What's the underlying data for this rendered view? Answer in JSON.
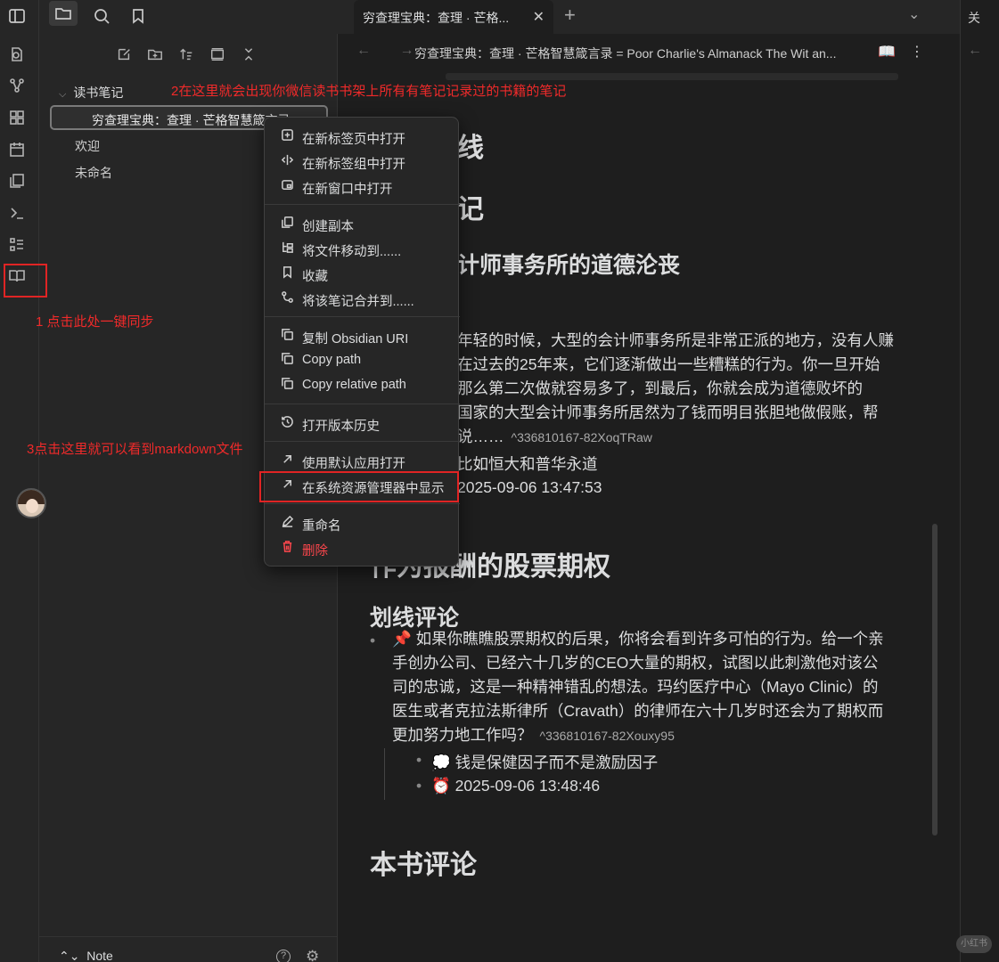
{
  "tab": {
    "title": "穷查理宝典：查理 · 芒格...",
    "close": "✕",
    "add": "+",
    "dropdown": "⌄"
  },
  "right_pane_tab": "关",
  "sidebar": {
    "folder": "读书笔记",
    "active_file": "穷查理宝典：查理 · 芒格智慧箴言录",
    "files": [
      "欢迎",
      "未命名"
    ],
    "vault_name": "Note",
    "help": "?"
  },
  "view": {
    "title": "穷查理宝典：查理 · 芒格智慧箴言录 = Poor Charlie's Almanack The Wit an...",
    "nav": "← →",
    "more": "⋮"
  },
  "content": {
    "h2_1": "线",
    "h2_2": "记",
    "h3_1": "计师事务所的道德沦丧",
    "para1_lines": [
      "年轻的时候，大型的会计师事务所是非常正派的地方，没有人赚",
      "在过去的25年来，它们逐渐做出一些糟糕的行为。你一旦开始",
      "那么第二次做就容易多了，到最后，你就会成为道德败坏的",
      "国家的大型会计师事务所居然为了钱而明目张胆地做假账，帮"
    ],
    "para1_last": "说……",
    "para1_ref": "^336810167-82XoqTRaw",
    "comment1": "比如恒大和普华永道",
    "time1": "2025-09-06 13:47:53",
    "h2_3": "作为报酬的股票期权",
    "h3_2": "划线评论",
    "para2_lines": [
      "📌 如果你瞧瞧股票期权的后果，你将会看到许多可怕的行为。给一个亲",
      "手创办公司、已经六十几岁的CEO大量的期权，试图以此刺激他对该公",
      "司的忠诚，这是一种精神错乱的想法。玛约医疗中心（Mayo Clinic）的",
      "医生或者克拉法斯律所（Cravath）的律师在六十几岁时还会为了期权而"
    ],
    "para2_last": "更加努力地工作吗？",
    "para2_ref": "^336810167-82Xouxy95",
    "comment2": "💭 钱是保健因子而不是激励因子",
    "time2": "⏰ 2025-09-06 13:48:46",
    "h2_4": "本书评论"
  },
  "context_menu": {
    "items": [
      {
        "icon": "new-tab-icon",
        "label": "在新标签页中打开"
      },
      {
        "icon": "split-icon",
        "label": "在新标签组中打开"
      },
      {
        "icon": "new-window-icon",
        "label": "在新窗口中打开"
      },
      {
        "icon": "copy-icon",
        "label": "创建副本"
      },
      {
        "icon": "move-icon",
        "label": "将文件移动到......"
      },
      {
        "icon": "bookmark-icon",
        "label": "收藏"
      },
      {
        "icon": "merge-icon",
        "label": "将该笔记合并到......"
      },
      {
        "icon": "link-icon",
        "label": "复制 Obsidian URI"
      },
      {
        "icon": "link-icon",
        "label": "Copy path"
      },
      {
        "icon": "link-icon",
        "label": "Copy relative path"
      },
      {
        "icon": "history-icon",
        "label": "打开版本历史"
      },
      {
        "icon": "external-icon",
        "label": "使用默认应用打开"
      },
      {
        "icon": "external-icon",
        "label": "在系统资源管理器中显示"
      },
      {
        "icon": "edit-icon",
        "label": "重命名"
      },
      {
        "icon": "trash-icon",
        "label": "删除"
      }
    ]
  },
  "annotations": {
    "a1": "1 点击此处一键同步",
    "a2": "2在这里就会出现你微信读书书架上所有有笔记记录过的书籍的笔记",
    "a3": "3点击这里就可以看到markdown文件"
  },
  "colors": {
    "accent_red": "#ef2a2a",
    "bg": "#1e1e1e",
    "sidebar": "#262626",
    "danger": "#fb464c"
  }
}
